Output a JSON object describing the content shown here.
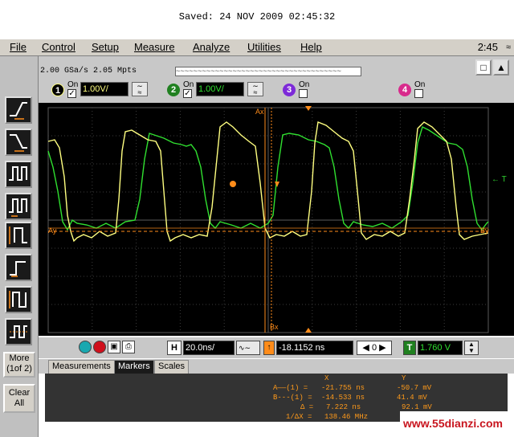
{
  "header": {
    "saved_text": "Saved:  24 NOV 2009  02:45:32"
  },
  "menu": {
    "items": [
      "File",
      "Control",
      "Setup",
      "Measure",
      "Analyze",
      "Utilities",
      "Help"
    ],
    "time": "2:45"
  },
  "left_panel": {
    "more_label": "More\n(1of 2)",
    "clear_label": "Clear\nAll"
  },
  "acquisition": {
    "rate": "2.00 GSa/s   2.05 Mpts"
  },
  "channels": [
    {
      "num": "1",
      "on_label": "On",
      "scale": "1.00V/",
      "enabled": true,
      "color": "#ffff80"
    },
    {
      "num": "2",
      "on_label": "On",
      "scale": "1.00V/",
      "enabled": true,
      "color": "#30e030"
    },
    {
      "num": "3",
      "on_label": "On",
      "enabled": false,
      "color": "#7d2ad8"
    },
    {
      "num": "4",
      "on_label": "On",
      "enabled": false,
      "color": "#d82a8c"
    }
  ],
  "markers_overlay": {
    "ax": "Ax",
    "bx": "Bx",
    "ay": "Ay",
    "by": "By",
    "trigger_label": "← T"
  },
  "timebase": {
    "h_label": "H",
    "scale": "20.0ns/",
    "position": "-18.1152 ns",
    "t_label": "T",
    "trigger_level": "1.760 V",
    "nav_value": "0"
  },
  "tabs": [
    "Measurements",
    "Markers",
    "Scales"
  ],
  "active_tab": "Markers",
  "marker_table": {
    "col_x": "X",
    "col_y": "Y",
    "rows": [
      {
        "label": "A——(1) =",
        "x": "-21.755 ns",
        "y": "-50.7 mV"
      },
      {
        "label": "B---(1) =",
        "x": "-14.533 ns",
        "y": "41.4 mV"
      },
      {
        "label": "Δ =",
        "x": "7.222 ns",
        "y": "92.1 mV"
      },
      {
        "label": "1/ΔX =",
        "x": "138.46 MHz",
        "y": ""
      }
    ]
  },
  "watermark": "www.55dianzi.com",
  "colors": {
    "ch1": "#ffff80",
    "ch2": "#30e030",
    "marker": "#ff8c1a",
    "grid": "#5a5a5a"
  }
}
